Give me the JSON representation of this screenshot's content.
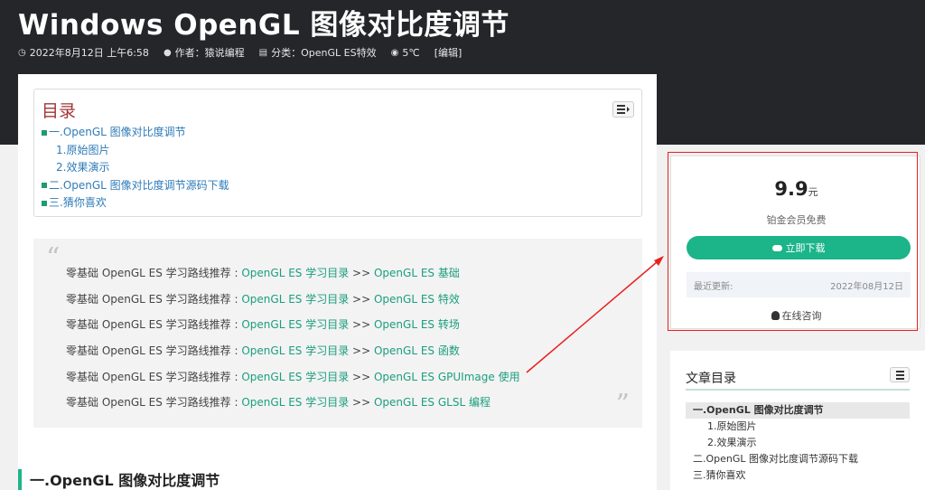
{
  "post": {
    "title": "Windows OpenGL 图像对比度调节",
    "meta": {
      "date": "2022年8月12日 上午6:58",
      "author": "作者：猿说编程",
      "category": "分类：OpenGL ES特效",
      "views": "5℃",
      "edit": "[编辑]"
    }
  },
  "icons": {
    "date": "clock-icon",
    "author": "user-icon",
    "category": "category-icon",
    "views": "eye-icon",
    "download": "cloud-download-icon",
    "consult": "qq-icon",
    "toggle": "list-toggle-icon"
  },
  "toc": {
    "title": "目录",
    "items": [
      {
        "label": "一.OpenGL 图像对比度调节",
        "level": 1
      },
      {
        "label": "1.原始图片",
        "level": 2
      },
      {
        "label": "2.效果演示",
        "level": 2
      },
      {
        "label": "二.OpenGL 图像对比度调节源码下载",
        "level": 1
      },
      {
        "label": "三.猜你喜欢",
        "level": 1
      }
    ]
  },
  "quote": {
    "open_mark": "“",
    "close_mark": "”",
    "lines": [
      {
        "prefix": "零基础 OpenGL ES 学习路线推荐 : ",
        "link1": "OpenGL ES 学习目录",
        "sep": " >> ",
        "link2": "OpenGL ES 基础"
      },
      {
        "prefix": "零基础 OpenGL ES 学习路线推荐 : ",
        "link1": "OpenGL ES 学习目录",
        "sep": "  >> ",
        "link2": "OpenGL ES 特效"
      },
      {
        "prefix": "零基础 OpenGL ES 学习路线推荐 : ",
        "link1": "OpenGL ES 学习目录",
        "sep": "  >> ",
        "link2": "OpenGL ES 转场"
      },
      {
        "prefix": "零基础 OpenGL ES 学习路线推荐 :  ",
        "link1": "OpenGL ES 学习目录",
        "sep": " >> ",
        "link2": "OpenGL ES 函数"
      },
      {
        "prefix": "零基础 OpenGL ES 学习路线推荐 :  ",
        "link1": "OpenGL ES 学习目录",
        "sep": " >> ",
        "link2": "OpenGL ES GPUImage 使用"
      },
      {
        "prefix": "零基础 OpenGL ES 学习路线推荐 :  ",
        "link1": "OpenGL ES 学习目录",
        "sep": " >> ",
        "link2": "OpenGL ES GLSL 编程"
      }
    ]
  },
  "section": {
    "heading": "一.OpenGL 图像对比度调节"
  },
  "purchase": {
    "price": "9.9",
    "unit": "元",
    "note": "铂金会员免费",
    "download_label": "立即下载",
    "updated_label": "最近更新:",
    "updated_date": "2022年08月12日",
    "consult_label": "在线咨询"
  },
  "sidebar_toc": {
    "title": "文章目录",
    "items": [
      {
        "label": "一.OpenGL 图像对比度调节",
        "level": 1,
        "active": true
      },
      {
        "label": "1.原始图片",
        "level": 2
      },
      {
        "label": "2.效果演示",
        "level": 2
      },
      {
        "label": "二.OpenGL 图像对比度调节源码下载",
        "level": 1
      },
      {
        "label": "三.猜你喜欢",
        "level": 1
      }
    ]
  },
  "colors": {
    "accent": "#1cb489",
    "link": "#1a9e7e",
    "toc_link": "#2e7bb8",
    "toc_title": "#a23535",
    "annotation": "#e8211d",
    "hero_bg": "#24262a"
  }
}
